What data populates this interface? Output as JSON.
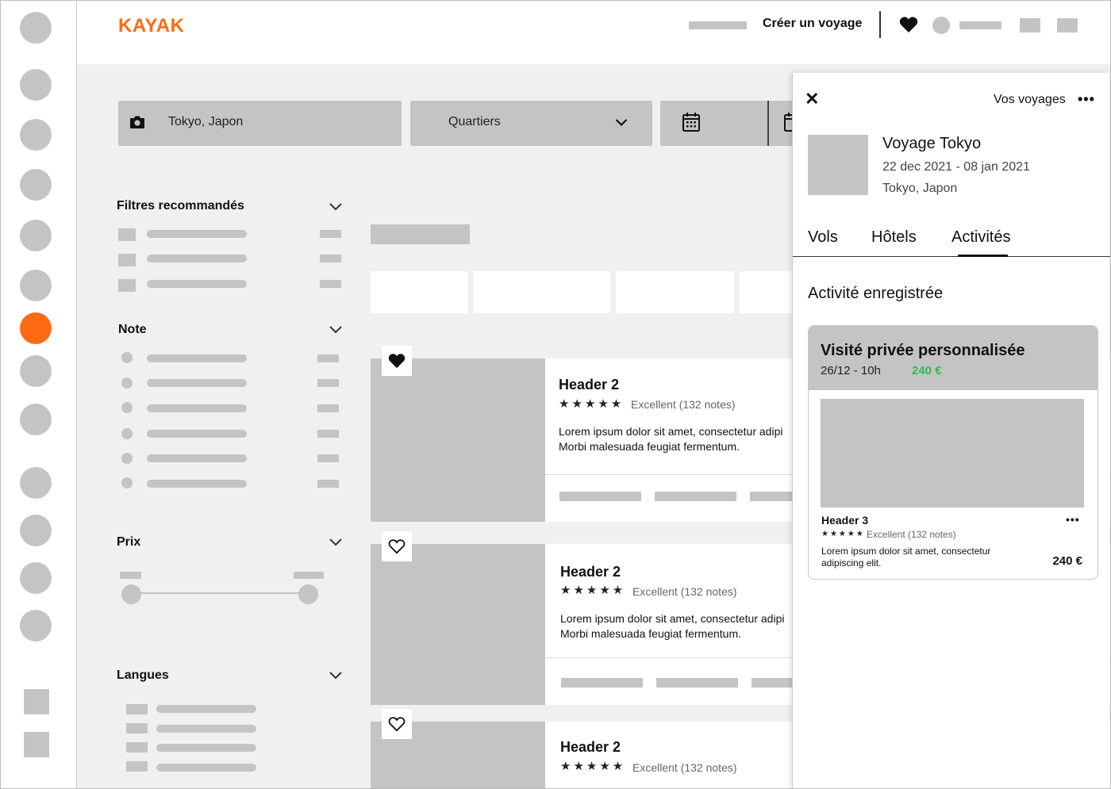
{
  "brand": {
    "logo": "KAYAK",
    "accent": "#ff6a13"
  },
  "topbar": {
    "create_trip": "Créer un voyage"
  },
  "search": {
    "destination": "Tokyo, Japon",
    "district": "Quartiers",
    "icons": [
      "camera-icon",
      "chevron-down-icon",
      "calendar-icon"
    ]
  },
  "filters": {
    "recommended": "Filtres recommandés",
    "rating": "Note",
    "price": "Prix",
    "languages": "Langues"
  },
  "results": [
    {
      "header": "Header 2",
      "stars": "★★★★★",
      "rating": "Excellent (132 notes)",
      "desc_line1": "Lorem ipsum dolor sit amet, consectetur adipi",
      "desc_line2": "Morbi malesuada feugiat fermentum.",
      "favorited": true
    },
    {
      "header": "Header 2",
      "stars": "★★★★★",
      "rating": "Excellent (132 notes)",
      "desc_line1": "Lorem ipsum dolor sit amet, consectetur adipi",
      "desc_line2": "Morbi malesuada feugiat fermentum.",
      "favorited": false
    },
    {
      "header": "Header 2",
      "stars": "★★★★★",
      "rating": "Excellent (132 notes)",
      "favorited": false
    }
  ],
  "panel": {
    "close": "✕",
    "title": "Vos voyages",
    "more": "•••",
    "trip": {
      "name": "Voyage Tokyo",
      "dates": "22 dec 2021 - 08 jan 2021",
      "location": "Tokyo, Japon"
    },
    "tabs": [
      "Vols",
      "Hôtels",
      "Activités"
    ],
    "active_tab": "Activités",
    "saved_title": "Activité enregistrée",
    "activity": {
      "title": "Visité privée personnalisée",
      "when": "26/12 - 10h",
      "price_highlight": "240 €",
      "header": "Header 3",
      "stars": "★★★★★",
      "rating": "Excellent (132 notes)",
      "desc": "Lorem ipsum dolor sit amet, consectetur adipiscing elit.",
      "price": "240 €",
      "more": "•••"
    }
  }
}
